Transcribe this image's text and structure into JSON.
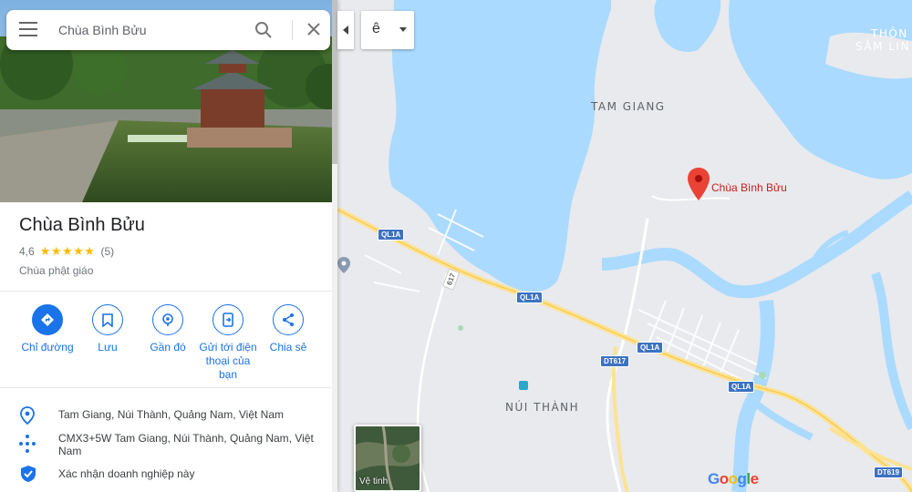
{
  "search": {
    "query": "Chùa Bình Bửu"
  },
  "place": {
    "name": "Chùa Bình Bửu",
    "rating": "4,6",
    "stars": "★★★★★",
    "reviews": "(5)",
    "category": "Chùa phật giáo"
  },
  "actions": [
    {
      "label": "Chỉ đường"
    },
    {
      "label": "Lưu"
    },
    {
      "label": "Gần đó"
    },
    {
      "label": "Gửi tới điện thoại của bạn"
    },
    {
      "label": "Chia sẻ"
    }
  ],
  "info": {
    "address": "Tam Giang, Núi Thành, Quảng Nam, Việt Nam",
    "plus_code": "CMX3+5W Tam Giang, Núi Thành, Quảng Nam, Việt Nam",
    "claim": "Xác nhận doanh nghiệp này"
  },
  "map": {
    "lang_value": "ê",
    "pin_label": "Chùa Bình Bửu",
    "labels": {
      "tam_giang": "TAM GIANG",
      "nui_thanh": "NÚI THÀNH",
      "thon": "THÔN",
      "sam_lin": "SÂM LIN"
    },
    "shields": {
      "ql1a": "QL1A",
      "dt617": "DT617",
      "dt619": "DT619",
      "r617": "617"
    },
    "satellite_label": "Vệ tinh",
    "google": "Google"
  },
  "colors": {
    "accent": "#1a73e8",
    "water": "#aadaff",
    "land": "#e8eaed",
    "pin": "#ea4335",
    "road": "#fde293"
  }
}
